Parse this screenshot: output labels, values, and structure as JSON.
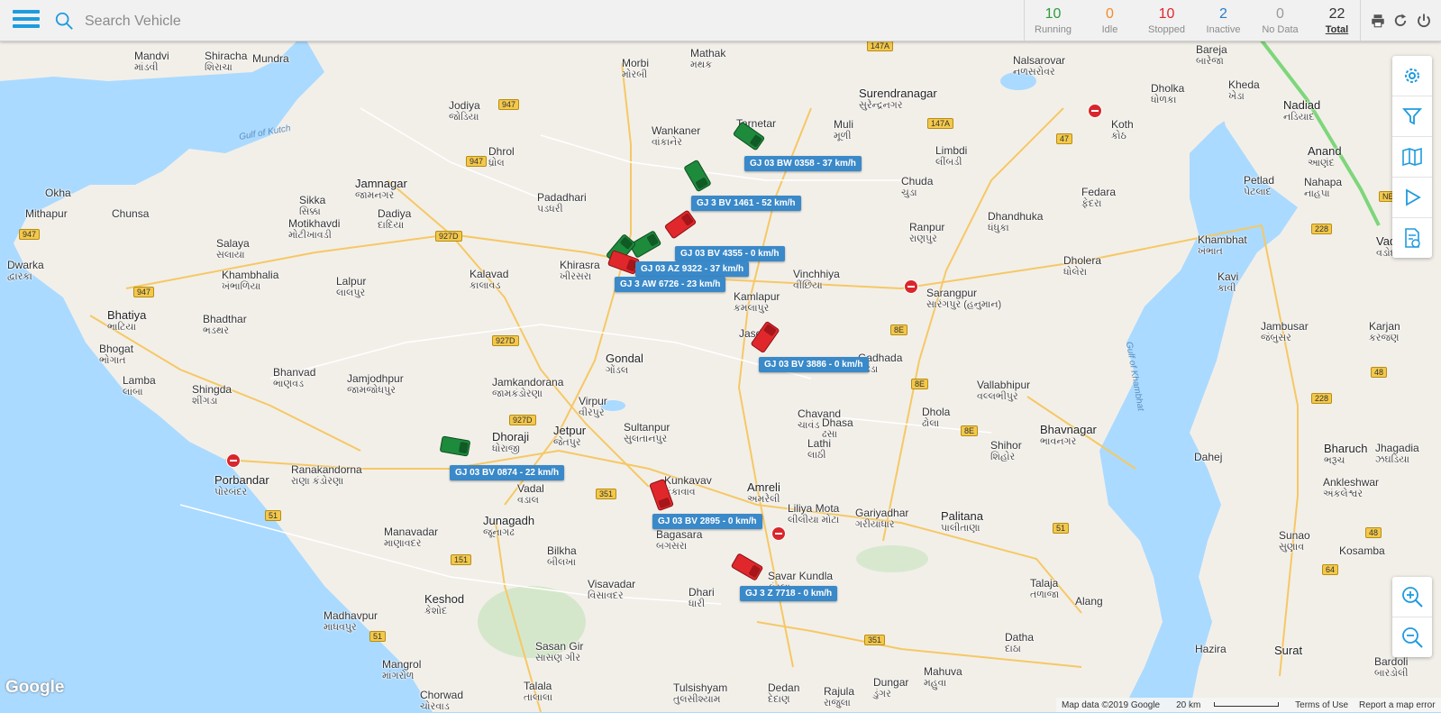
{
  "search": {
    "placeholder": "Search Vehicle"
  },
  "stats": [
    {
      "count": "10",
      "label": "Running",
      "color": "#2e9c3c"
    },
    {
      "count": "0",
      "label": "Idle",
      "color": "#f28b2e"
    },
    {
      "count": "10",
      "label": "Stopped",
      "color": "#e0282c"
    },
    {
      "count": "2",
      "label": "Inactive",
      "color": "#2a7ec6"
    },
    {
      "count": "0",
      "label": "No Data",
      "color": "#9a9a9a"
    },
    {
      "count": "22",
      "label": "Total",
      "color": "#333333"
    }
  ],
  "vehicles": [
    {
      "label": "GJ 03 BW 0358 - 37 km/h",
      "status": "running"
    },
    {
      "label": "GJ 3 BV 1461 - 52 km/h",
      "status": "running"
    },
    {
      "label": "GJ 03 BV 4355 - 0 km/h",
      "status": "stopped"
    },
    {
      "label": "GJ 03 AZ 9322 - 37 km/h",
      "status": "running"
    },
    {
      "label": "GJ 3 AW 6726 - 23 km/h",
      "status": "running"
    },
    {
      "label": "GJ 03 BV 3886 - 0 km/h",
      "status": "stopped"
    },
    {
      "label": "GJ 03 BV 0874 - 22 km/h",
      "status": "running"
    },
    {
      "label": "GJ 03 BV 2895 - 0 km/h",
      "status": "stopped"
    },
    {
      "label": "GJ 3 Z 7718 - 0 km/h",
      "status": "stopped"
    }
  ],
  "places": [
    {
      "name": "Mandvi",
      "alt": "માંડવી"
    },
    {
      "name": "Shiracha",
      "alt": "શિરાચા"
    },
    {
      "name": "Mundra",
      "alt": ""
    },
    {
      "name": "Morbi",
      "alt": "મોરબી"
    },
    {
      "name": "Mathak",
      "alt": "મથક"
    },
    {
      "name": "Surendranagar",
      "alt": "સુરેન્દ્રનગર"
    },
    {
      "name": "Nalsarovar",
      "alt": "નળસરોવર"
    },
    {
      "name": "Bareja",
      "alt": "બારેજા"
    },
    {
      "name": "Jodiya",
      "alt": "જોડિયા"
    },
    {
      "name": "Tarnetar",
      "alt": ""
    },
    {
      "name": "Muli",
      "alt": "મૂળી"
    },
    {
      "name": "Dholka",
      "alt": "ધોળકા"
    },
    {
      "name": "Kheda",
      "alt": "ખેડા"
    },
    {
      "name": "Nadiad",
      "alt": "નડિયાદ"
    },
    {
      "name": "Wankaner",
      "alt": "વાંકાનેર"
    },
    {
      "name": "Koth",
      "alt": "કોઠ"
    },
    {
      "name": "Dhrol",
      "alt": "ધ્રોલ"
    },
    {
      "name": "Limbdi",
      "alt": "લીંબડી"
    },
    {
      "name": "Anand",
      "alt": "આણંદ"
    },
    {
      "name": "Okha",
      "alt": ""
    },
    {
      "name": "Jamnagar",
      "alt": "જામનગર"
    },
    {
      "name": "Padadhari",
      "alt": "પડધરી"
    },
    {
      "name": "Chuda",
      "alt": "ચુડા"
    },
    {
      "name": "Fedara",
      "alt": "ફેદરા"
    },
    {
      "name": "Petlad",
      "alt": "પેટલાદ"
    },
    {
      "name": "Nahapa",
      "alt": "નાહપા"
    },
    {
      "name": "Mithapur",
      "alt": ""
    },
    {
      "name": "Chunsa",
      "alt": ""
    },
    {
      "name": "Sikka",
      "alt": "સિક્કા"
    },
    {
      "name": "Motikhavdi",
      "alt": "મોટીખાવડી"
    },
    {
      "name": "Dadiya",
      "alt": "દાદિયા"
    },
    {
      "name": "Ranpur",
      "alt": "રાણપુર"
    },
    {
      "name": "Dhandhuka",
      "alt": "ધંધુકા"
    },
    {
      "name": "Salaya",
      "alt": "સલાયા"
    },
    {
      "name": "Khambhat",
      "alt": "ખંભાત"
    },
    {
      "name": "Vadodara",
      "alt": "વડોદરા"
    },
    {
      "name": "Dwarka",
      "alt": "દ્વારકા"
    },
    {
      "name": "Khambhalia",
      "alt": "ખંભાળિયા"
    },
    {
      "name": "Kalavad",
      "alt": "કાલાવડ"
    },
    {
      "name": "Khirasra",
      "alt": "ખીરસરા"
    },
    {
      "name": "Vinchhiya",
      "alt": "વીંછિયા"
    },
    {
      "name": "Dholera",
      "alt": "ધોલેરા"
    },
    {
      "name": "Lalpur",
      "alt": "લાલપુર"
    },
    {
      "name": "Kamlapur",
      "alt": "કમલાપુર"
    },
    {
      "name": "Sarangpur",
      "alt": "સારંગપુર (હનુમાન)"
    },
    {
      "name": "Kavi",
      "alt": "કાવી"
    },
    {
      "name": "Bhatiya",
      "alt": "ભાટિયા"
    },
    {
      "name": "Bhadthar",
      "alt": "ભડથર"
    },
    {
      "name": "Jambusar",
      "alt": "જંબુસર"
    },
    {
      "name": "Karjan",
      "alt": "કરજણ"
    },
    {
      "name": "Bhogat",
      "alt": "ભોગાત"
    },
    {
      "name": "Gondal",
      "alt": "ગોંડલ"
    },
    {
      "name": "Gadhada",
      "alt": "ગઢડા"
    },
    {
      "name": "Lamba",
      "alt": "લાંબા"
    },
    {
      "name": "Bhanvad",
      "alt": "ભાણવડ"
    },
    {
      "name": "Jamjodhpur",
      "alt": "જામજોધપુર"
    },
    {
      "name": "Shingda",
      "alt": "શીંગડા"
    },
    {
      "name": "Jamkandorana",
      "alt": "જામકંડોરણા"
    },
    {
      "name": "Vallabhipur",
      "alt": "વલ્લભીપુર"
    },
    {
      "name": "Virpur",
      "alt": "વીરપુર"
    },
    {
      "name": "Chavand",
      "alt": "ચાવંડ"
    },
    {
      "name": "Dhola",
      "alt": "ઢોલા"
    },
    {
      "name": "Sultanpur",
      "alt": "સુલતાનપુર"
    },
    {
      "name": "Dhasa",
      "alt": "ઢસા"
    },
    {
      "name": "Bhavnagar",
      "alt": "ભાવનગર"
    },
    {
      "name": "Bharuch",
      "alt": "ભરૂચ"
    },
    {
      "name": "Jhagadia",
      "alt": "ઝઘડિયા"
    },
    {
      "name": "Jetpur",
      "alt": "જેતપુર"
    },
    {
      "name": "Dhoraji",
      "alt": "ધોરાજી"
    },
    {
      "name": "Lathi",
      "alt": "લાઠી"
    },
    {
      "name": "Shihor",
      "alt": "શિહોર"
    },
    {
      "name": "Dahej",
      "alt": ""
    },
    {
      "name": "Ankleshwar",
      "alt": "અંકલેશ્વર"
    },
    {
      "name": "Porbandar",
      "alt": "પોરબંદર"
    },
    {
      "name": "Ranakandorna",
      "alt": "રાણા કંડોરણા"
    },
    {
      "name": "Vadal",
      "alt": "વડાલ"
    },
    {
      "name": "Kunkavav",
      "alt": "કુંકાવાવ"
    },
    {
      "name": "Amreli",
      "alt": "અમરેલી"
    },
    {
      "name": "Liliya Mota",
      "alt": "લીલીયા મોટા"
    },
    {
      "name": "Gariyadhar",
      "alt": "ગરીયાધાર"
    },
    {
      "name": "Palitana",
      "alt": "પાલીતાણા"
    },
    {
      "name": "Junagadh",
      "alt": "જૂનાગઢ"
    },
    {
      "name": "Manavadar",
      "alt": "માણાવદર"
    },
    {
      "name": "Bagasara",
      "alt": "બગસરા"
    },
    {
      "name": "Sunao",
      "alt": "સુણાવ"
    },
    {
      "name": "Kosamba",
      "alt": ""
    },
    {
      "name": "Bilkha",
      "alt": "બીલખા"
    },
    {
      "name": "Visavadar",
      "alt": "વિસાવદર"
    },
    {
      "name": "Savar Kundla",
      "alt": "કુંડલા"
    },
    {
      "name": "Talaja",
      "alt": "તળાજા"
    },
    {
      "name": "Alang",
      "alt": ""
    },
    {
      "name": "Keshod",
      "alt": "કેશોદ"
    },
    {
      "name": "Dhari",
      "alt": "ધારી"
    },
    {
      "name": "Madhavpur",
      "alt": "માધવપુર"
    },
    {
      "name": "Datha",
      "alt": "દાઠા"
    },
    {
      "name": "Hazira",
      "alt": ""
    },
    {
      "name": "Surat",
      "alt": ""
    },
    {
      "name": "Sasan Gir",
      "alt": "સાસણ ગીર"
    },
    {
      "name": "Mangrol",
      "alt": "માંગરોળ"
    },
    {
      "name": "Mahuva",
      "alt": "મહુવા"
    },
    {
      "name": "Bardoli",
      "alt": "બારડોલી"
    },
    {
      "name": "Chorwad",
      "alt": "ચોરવાડ"
    },
    {
      "name": "Talala",
      "alt": "તાલાલા"
    },
    {
      "name": "Tulsishyam",
      "alt": "તુલસીશ્યામ"
    },
    {
      "name": "Dedan",
      "alt": "દેદાણ"
    },
    {
      "name": "Rajula",
      "alt": "રાજુલા"
    },
    {
      "name": "Dungar",
      "alt": "ડુંગર"
    },
    {
      "name": "Jasdan",
      "alt": ""
    }
  ],
  "water_labels": [
    "Gulf of Kutch",
    "Gulf of Khambhat"
  ],
  "road_shields": [
    "147A",
    "947",
    "147A",
    "47",
    "947",
    "927D",
    "947",
    "927D",
    "947",
    "8E",
    "927D",
    "8E",
    "8E",
    "48",
    "228",
    "228",
    "351",
    "51",
    "151",
    "51",
    "351",
    "51",
    "64",
    "48",
    "NE"
  ],
  "attribution": {
    "logo": "Google",
    "map_data": "Map data ©2019 Google",
    "scale": "20 km",
    "terms": "Terms of Use",
    "report": "Report a map error"
  },
  "colors": {
    "running": "#1e8a3c",
    "stopped": "#e0282c",
    "label_bg": "#3a89c9",
    "accent": "#1e9be0"
  }
}
